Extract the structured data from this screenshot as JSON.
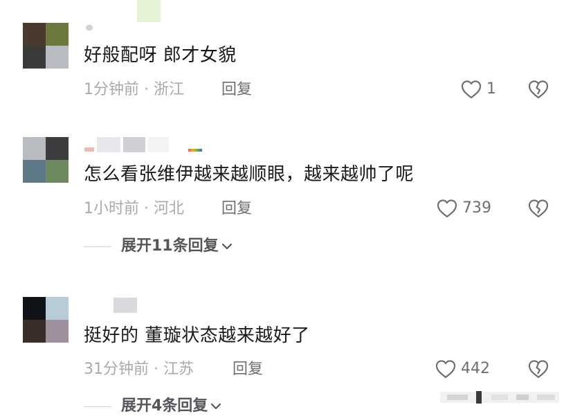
{
  "comments": [
    {
      "text": "好般配呀 郎才女貌",
      "time": "1分钟前",
      "dot": "·",
      "location": "浙江",
      "reply_label": "回复",
      "likes": "1",
      "avatar_colors": [
        "#4a3a2e",
        "#6b7a3c",
        "#3a3a3a",
        "#b9bcc2"
      ]
    },
    {
      "text": "怎么看张维伊越来越顺眼，越来越帅了呢",
      "time": "1小时前",
      "dot": "·",
      "location": "河北",
      "reply_label": "回复",
      "likes": "739",
      "expand_label": "展开11条回复",
      "avatar_colors": [
        "#b9bcc0",
        "#3d3d3f",
        "#5e7a88",
        "#6f8a60"
      ]
    },
    {
      "text": "挺好的 董璇状态越来越好了",
      "time": "31分钟前",
      "dot": "·",
      "location": "江苏",
      "reply_label": "回复",
      "likes": "442",
      "expand_label": "展开4条回复",
      "avatar_colors": [
        "#101418",
        "#b8ccd8",
        "#3b2e2a",
        "#9e909c"
      ]
    }
  ],
  "icons": {
    "like": "heart-outline-icon",
    "dislike": "broken-heart-icon",
    "expand": "chevron-down-icon"
  },
  "colors": {
    "text": "#1a1a1a",
    "meta": "#a9a9ae",
    "action": "#6e6e73"
  }
}
